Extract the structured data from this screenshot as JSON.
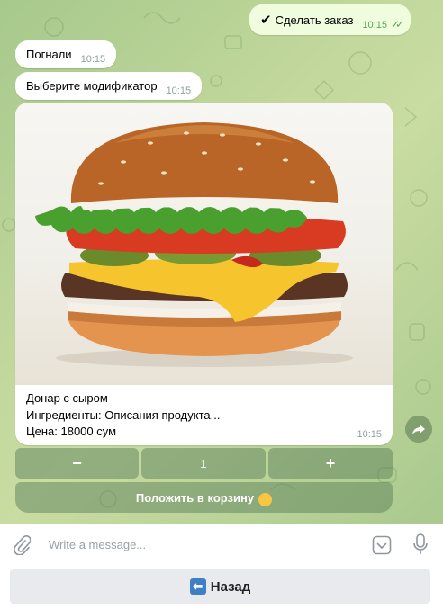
{
  "messages": {
    "outgoing": {
      "text": "Сделать заказ",
      "time": "10:15"
    },
    "incoming_1": {
      "text": "Погнали",
      "time": "10:15"
    },
    "incoming_2": {
      "text": "Выберите модификатор",
      "time": "10:15"
    }
  },
  "product": {
    "name": "Донар с сыром",
    "ingredients": "Ингредиенты: Описания продукта...",
    "price": "Цена: 18000 сум",
    "time": "10:15"
  },
  "keyboard": {
    "minus": "−",
    "quantity": "1",
    "plus": "+",
    "add_to_cart": "Положить в корзину"
  },
  "composer": {
    "placeholder": "Write a message..."
  },
  "reply_keyboard": {
    "back": "Назад"
  },
  "colors": {
    "chat_bg": "#b9d497",
    "bubble_out": "#effdde",
    "inline_button": "#5a7d5a",
    "check_green": "#5ca853"
  },
  "icons": {
    "check": "check-icon",
    "attach": "paperclip-icon",
    "emoji": "smile-icon",
    "mic": "microphone-icon",
    "share": "share-arrow-icon",
    "back": "back-arrow-icon"
  }
}
